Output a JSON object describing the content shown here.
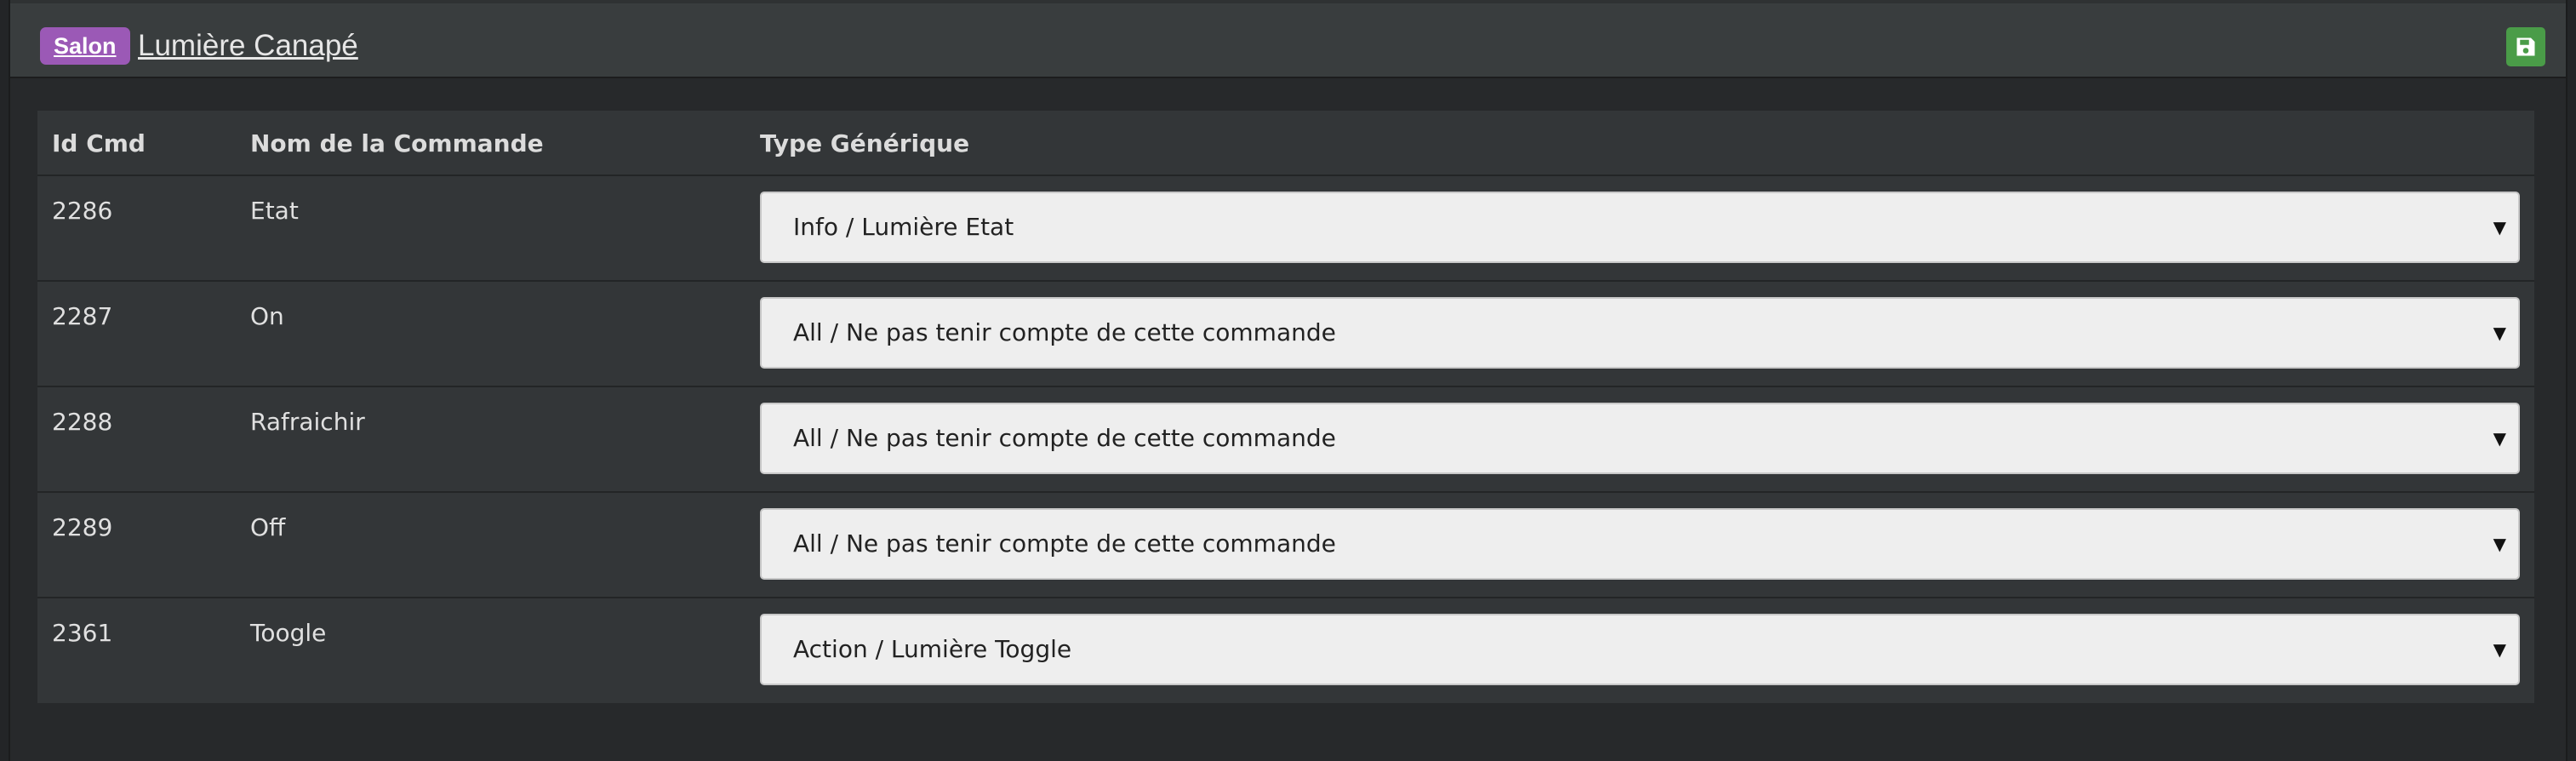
{
  "header": {
    "badge": "Salon",
    "equipment_name": "Lumière Canapé",
    "save_icon": "floppy-disk-icon",
    "colors": {
      "badge": "#9b59b6",
      "save": "#4a9c48"
    }
  },
  "table": {
    "columns": {
      "id": "Id Cmd",
      "name": "Nom de la Commande",
      "type": "Type Générique"
    },
    "rows": [
      {
        "id": "2286",
        "name": "Etat",
        "type": "Info / Lumière Etat"
      },
      {
        "id": "2287",
        "name": "On",
        "type": "All / Ne pas tenir compte de cette commande"
      },
      {
        "id": "2288",
        "name": "Rafraichir",
        "type": "All / Ne pas tenir compte de cette commande"
      },
      {
        "id": "2289",
        "name": "Off",
        "type": "All / Ne pas tenir compte de cette commande"
      },
      {
        "id": "2361",
        "name": "Toogle",
        "type": "Action / Lumière Toggle"
      }
    ],
    "dropdown_icon": "caret-down-icon"
  }
}
